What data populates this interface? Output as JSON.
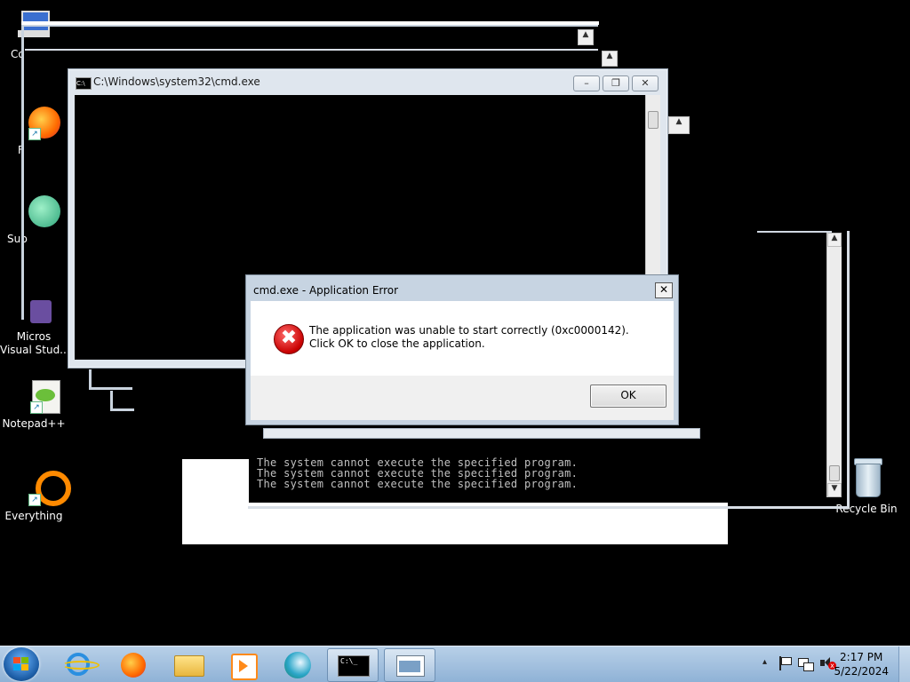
{
  "desktop": {
    "icons": [
      {
        "label": "Co",
        "icon": "computer-icon"
      },
      {
        "label": "F",
        "icon": "firefox-icon"
      },
      {
        "label": "Sup",
        "icon": "support-icon"
      },
      {
        "label": "Micros\nVisual Stud...",
        "icon": "visual-studio-icon"
      },
      {
        "label": "Notepad++",
        "icon": "notepadpp-icon"
      },
      {
        "label": "Everything",
        "icon": "everything-icon"
      },
      {
        "label": "Recycle Bin",
        "icon": "recycle-bin-icon"
      }
    ]
  },
  "cmd_window": {
    "title": "C:\\Windows\\system32\\cmd.exe",
    "icon_text": "C:\\",
    "buttons": {
      "minimize": "–",
      "restore": "❐",
      "close": "✕"
    }
  },
  "console_output": [
    "The system cannot execute the specified program.",
    "The system cannot execute the specified program.",
    "The system cannot execute the specified program."
  ],
  "error_dialog": {
    "title": "cmd.exe - Application Error",
    "close_glyph": "✕",
    "icon_glyph": "✖",
    "message": "The application was unable to start correctly (0xc0000142). Click OK to close the application.",
    "ok_label": "OK"
  },
  "taskbar": {
    "pinned": [
      "internet-explorer-icon",
      "firefox-icon",
      "file-explorer-icon",
      "media-player-icon",
      "app-icon",
      "cmd-icon",
      "window-icon"
    ],
    "clock_time": "2:17 PM",
    "clock_date": "5/22/2024",
    "tray_chevron": "▴"
  },
  "colors": {
    "error_red": "#c80000",
    "taskbar": "#a9c6e3",
    "dialog_frame": "#c7d4e2"
  }
}
